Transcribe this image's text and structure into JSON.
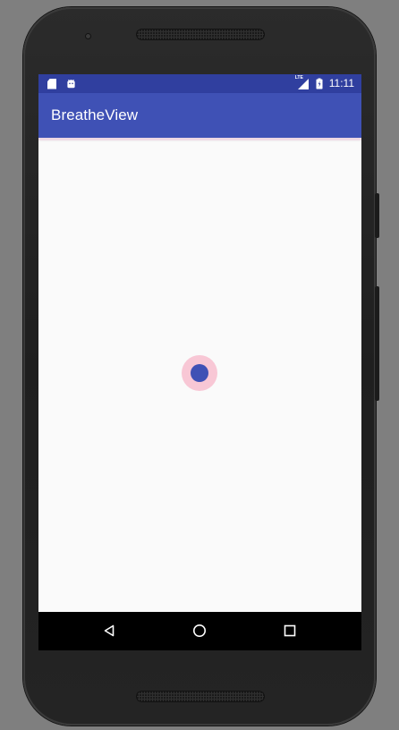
{
  "status_bar": {
    "left_icons": [
      "sd-card-icon",
      "android-icon"
    ],
    "network": "LTE",
    "time": "11:11",
    "right_icons": [
      "signal-icon",
      "battery-charging-icon"
    ],
    "colors": {
      "background": "#303f9f",
      "foreground": "#ffffff"
    }
  },
  "app_bar": {
    "title": "BreatheView",
    "colors": {
      "background": "#3f51b5",
      "text": "#ffffff"
    }
  },
  "content": {
    "indicator": {
      "outer_color": "#f8c7d5",
      "inner_color": "#3f51b5"
    },
    "background": "#fafafa"
  },
  "navigation_bar": {
    "buttons": [
      "back-icon",
      "home-icon",
      "overview-icon"
    ],
    "colors": {
      "background": "#000000",
      "icon": "#ffffff"
    }
  }
}
